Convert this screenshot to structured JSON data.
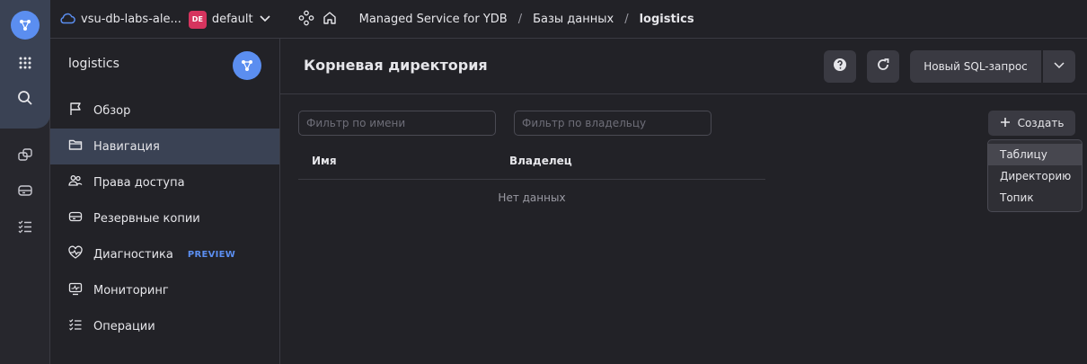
{
  "topbar": {
    "cloud_name": "vsu-db-labs-ale...",
    "folder_badge": "DE",
    "folder_name": "default",
    "breadcrumbs": [
      "Managed Service for YDB",
      "Базы данных",
      "logistics"
    ]
  },
  "sidebar": {
    "title": "logistics",
    "items": [
      {
        "label": "Обзор",
        "icon": "flag-icon"
      },
      {
        "label": "Навигация",
        "icon": "folder-icon"
      },
      {
        "label": "Права доступа",
        "icon": "users-icon"
      },
      {
        "label": "Резервные копии",
        "icon": "drive-icon"
      },
      {
        "label": "Диагностика",
        "icon": "heart-pulse-icon",
        "badge": "PREVIEW"
      },
      {
        "label": "Мониторинг",
        "icon": "monitor-icon"
      },
      {
        "label": "Операции",
        "icon": "list-check-icon"
      }
    ],
    "active_index": 1
  },
  "main": {
    "title": "Корневая директория",
    "new_sql_label": "Новый SQL-запрос",
    "filter_name_placeholder": "Фильтр по имени",
    "filter_owner_placeholder": "Фильтр по владельцу",
    "create_label": "Создать",
    "columns": [
      "Имя",
      "Владелец"
    ],
    "empty_text": "Нет данных",
    "create_menu": [
      "Таблицу",
      "Директорию",
      "Топик"
    ]
  },
  "colors": {
    "accent": "#5b8ef0",
    "active_bg": "#3a4254",
    "badge_de": "#d6345e"
  }
}
